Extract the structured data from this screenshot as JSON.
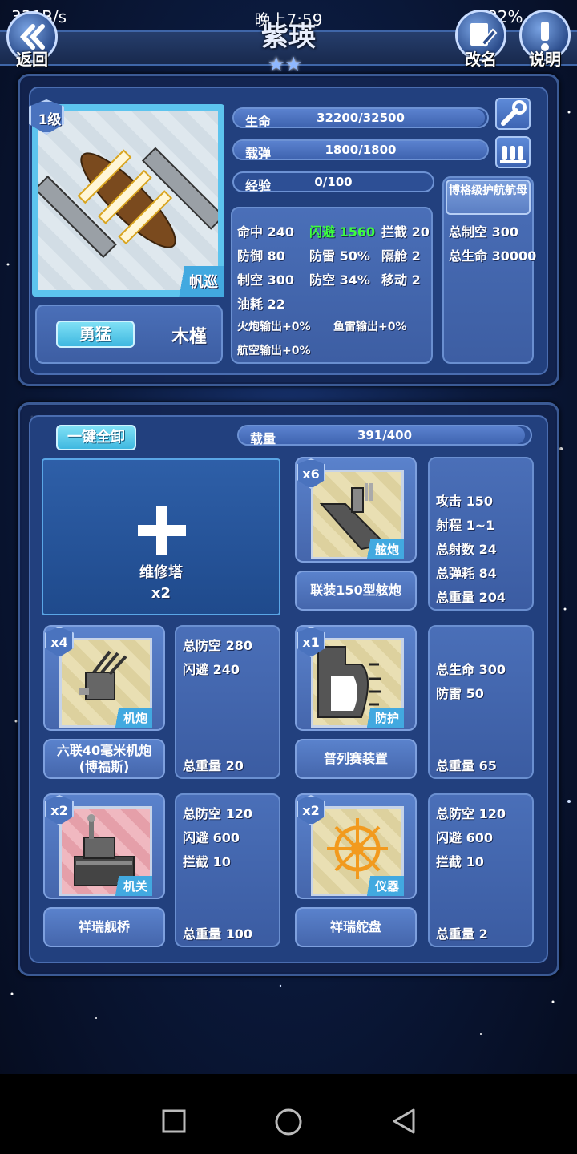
{
  "status_bar": {
    "speed": "331B/s",
    "time": "晚上7:59",
    "battery": "82%"
  },
  "header": {
    "back_label": "返回",
    "ship_name": "紫瑛",
    "rename_label": "改名",
    "help_label": "说明",
    "stars": "★★"
  },
  "ship": {
    "level": "1级",
    "type": "帆巡",
    "personality": "勇猛",
    "name": "木槿",
    "hp_label": "生命",
    "hp_value": "32200/32500",
    "hp_fraction": 0.99,
    "ammo_label": "载弹",
    "ammo_value": "1800/1800",
    "ammo_fraction": 1.0,
    "exp_label": "经验",
    "exp_value": "0/100",
    "exp_fraction": 0.0,
    "stats": {
      "accuracy": "命中 240",
      "evasion": "闪避 1560",
      "intercept": "拦截 20",
      "defense": "防御 80",
      "torp_def": "防雷 50%",
      "bulkhead": "隔舱 2",
      "air_control": "制空 300",
      "aa_def": "防空 34%",
      "move": "移动 2",
      "fuel": "油耗 22",
      "gun_out": "火炮输出+0%",
      "torp_out": "鱼雷输出+0%",
      "air_out": "航空输出+0%"
    },
    "escort": {
      "title": "博格级护航航母",
      "air": "总制空 300",
      "hp": "总生命 30000"
    }
  },
  "equipment": {
    "unload_all": "一键全卸",
    "load_label": "载量",
    "load_value": "391/400",
    "load_fraction": 0.98,
    "repair": {
      "name": "维修塔",
      "count": "x2"
    },
    "items": [
      {
        "badge": "x6",
        "tag": "舷炮",
        "name": "联装150型舷炮",
        "stats_top": [
          "攻击 150",
          "射程 1~1",
          "总射数 24",
          "总弹耗 84",
          "总重量 204"
        ],
        "weight": ""
      },
      {
        "badge": "x4",
        "tag": "机炮",
        "name_line1": "六联40毫米机炮",
        "name_line2": "(博福斯)",
        "stats_top": [
          "总防空 280",
          "闪避 240"
        ],
        "weight": "总重量 20"
      },
      {
        "badge": "x1",
        "tag": "防护",
        "name": "普列赛装置",
        "stats_top": [
          "总生命 300",
          "防雷 50"
        ],
        "weight": "总重量 65"
      },
      {
        "badge": "x2",
        "tag": "机关",
        "name": "祥瑞舰桥",
        "stats_top": [
          "总防空 120",
          "闪避 600",
          "拦截 10"
        ],
        "weight": "总重量 100"
      },
      {
        "badge": "x2",
        "tag": "仪器",
        "name": "祥瑞舵盘",
        "stats_top": [
          "总防空 120",
          "闪避 600",
          "拦截 10"
        ],
        "weight": "总重量 2"
      }
    ]
  },
  "colors": {
    "accent": "#4a73be",
    "evasion_highlight": "#3dff3d",
    "tag": "#42a9e0"
  }
}
